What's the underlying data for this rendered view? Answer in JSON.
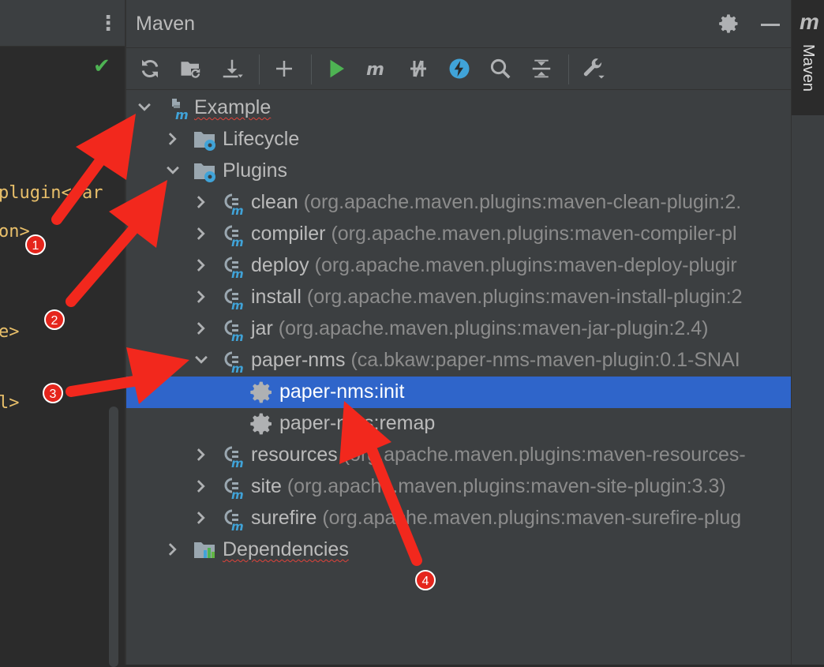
{
  "editor": {
    "code_lines": [
      "plugin</ar",
      "on>",
      "e>",
      "l>"
    ]
  },
  "panel": {
    "title": "Maven"
  },
  "side_tab": {
    "label": "Maven",
    "icon_letter": "m"
  },
  "toolbar": {
    "icons": [
      "reload-icon",
      "folder-reload-icon",
      "download-icon",
      "add-icon",
      "run-icon",
      "maven-goal-icon",
      "toggle-offline-icon",
      "skip-tests-icon",
      "search-icon",
      "collapse-all-icon",
      "settings-wrench-icon"
    ]
  },
  "tree": {
    "project": "Example",
    "lifecycle": "Lifecycle",
    "plugins": "Plugins",
    "dependencies": "Dependencies",
    "plugin_items": [
      {
        "name": "clean",
        "coords": "(org.apache.maven.plugins:maven-clean-plugin:2."
      },
      {
        "name": "compiler",
        "coords": "(org.apache.maven.plugins:maven-compiler-pl"
      },
      {
        "name": "deploy",
        "coords": "(org.apache.maven.plugins:maven-deploy-plugir"
      },
      {
        "name": "install",
        "coords": "(org.apache.maven.plugins:maven-install-plugin:2"
      },
      {
        "name": "jar",
        "coords": "(org.apache.maven.plugins:maven-jar-plugin:2.4)"
      },
      {
        "name": "paper-nms",
        "coords": "(ca.bkaw:paper-nms-maven-plugin:0.1-SNAI"
      },
      {
        "name": "resources",
        "coords": "(org.apache.maven.plugins:maven-resources-"
      },
      {
        "name": "site",
        "coords": "(org.apache.maven.plugins:maven-site-plugin:3.3)"
      },
      {
        "name": "surefire",
        "coords": "(org.apache.maven.plugins:maven-surefire-plug"
      }
    ],
    "goals": [
      "paper-nms:init",
      "paper-nms:remap"
    ]
  },
  "annotations": {
    "badges": [
      "1",
      "2",
      "3",
      "4"
    ]
  },
  "colors": {
    "selection": "#2f65ca",
    "annotation_red": "#e5251c",
    "maven_blue": "#40a3d8",
    "run_green": "#4eb353"
  }
}
